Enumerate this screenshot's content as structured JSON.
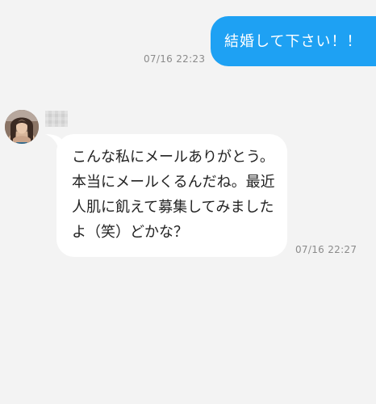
{
  "messages": [
    {
      "direction": "sent",
      "text": "結婚して下さい！！",
      "time": "07/16 22:23",
      "bubble_color": "#1ea1f3"
    },
    {
      "direction": "received",
      "lines": [
        "こんな私にメールありがとう。",
        "本当にメールくるんだね。最近",
        "人肌に飢えて募集してみました",
        "よ（笑）どかな？"
      ],
      "time": "07/16 22:27",
      "bubble_color": "#ffffff"
    }
  ],
  "sender": {
    "avatar_icon": "profile-photo-avatar",
    "name_pixelated": true
  },
  "background_color": "#f3f3f3"
}
